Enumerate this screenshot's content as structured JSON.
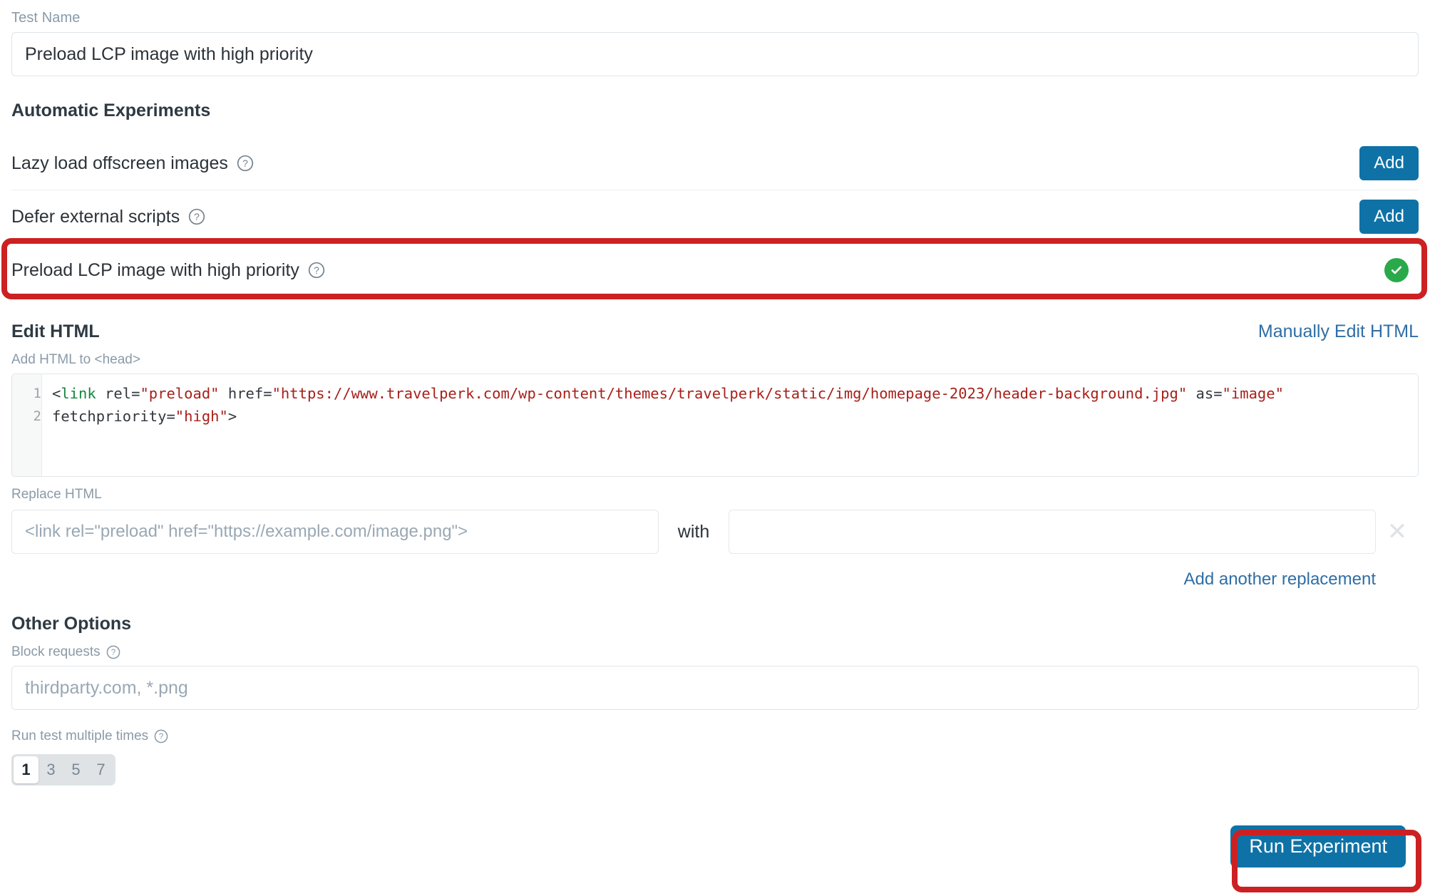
{
  "test_name": {
    "label": "Test Name",
    "value": "Preload LCP image with high priority"
  },
  "automatic_experiments": {
    "heading": "Automatic Experiments",
    "rows": [
      {
        "label": "Lazy load offscreen images",
        "action": "Add",
        "state": "add"
      },
      {
        "label": "Defer external scripts",
        "action": "Add",
        "state": "add"
      },
      {
        "label": "Preload LCP image with high priority",
        "action": "",
        "state": "enabled"
      }
    ]
  },
  "edit_html": {
    "heading": "Edit HTML",
    "manual_link": "Manually Edit HTML",
    "add_head_label": "Add HTML to <head>",
    "line_numbers": [
      "1",
      "2"
    ],
    "code": {
      "full_text": "<link rel=\"preload\" href=\"https://www.travelperk.com/wp-content/themes/travelperk/static/img/homepage-2023/header-background.jpg\" as=\"image\" fetchpriority=\"high\">",
      "tokens": {
        "open_bracket": "<",
        "tag": "link",
        "attr_rel": " rel=",
        "val_rel": "\"preload\"",
        "attr_href": " href=",
        "val_href": "\"https://www.travelperk.com/wp-content/themes/travelperk/static/img/homepage-2023/header-background.jpg\"",
        "attr_as": " as=",
        "val_as": "\"image\"",
        "attr_fetch": "fetchpriority=",
        "val_fetch": "\"high\"",
        "close_bracket": ">"
      }
    }
  },
  "replace_html": {
    "label": "Replace HTML",
    "find_placeholder": "<link rel=\"preload\" href=\"https://example.com/image.png\">",
    "find_value": "",
    "with_label": "with",
    "replace_placeholder": "",
    "replace_value": "",
    "remove_icon": "✕",
    "add_another_link": "Add another replacement"
  },
  "other_options": {
    "heading": "Other Options",
    "block_requests": {
      "label": "Block requests",
      "placeholder": "thirdparty.com, *.png",
      "value": ""
    },
    "run_multiple": {
      "label": "Run test multiple times",
      "options": [
        "1",
        "3",
        "5",
        "7"
      ],
      "selected": "1"
    }
  },
  "footer": {
    "run_button": "Run Experiment"
  },
  "colors": {
    "primary_blue": "#0f72a6",
    "link_blue": "#2f6ea5",
    "success_green": "#2aa94a",
    "annotation_red": "#cc2122",
    "muted_label": "#8a9aa8",
    "code_string": "#a8201a",
    "code_tag": "#168540"
  }
}
